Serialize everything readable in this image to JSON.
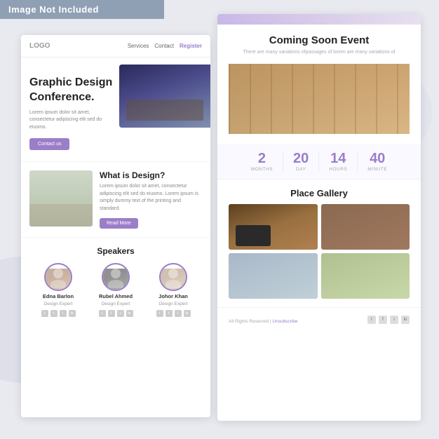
{
  "banner": {
    "text": "Image Not Included"
  },
  "card_left": {
    "nav": {
      "logo": "LOGO",
      "links": [
        "Services",
        "Contact"
      ],
      "register": "Register"
    },
    "hero": {
      "title": "Graphic Design Conference.",
      "description": "Lorem ipsum dolor sit amet, consectetur adipiscing elit  sed do eiusmo.",
      "button": "Contact us"
    },
    "what": {
      "title": "What is Design?",
      "description": "Lorem ipsum dolor sit amet, consectetur adipiscing elit  sed do eiusmo. Lorem ipsum is simply dummy text of the printing and standard.",
      "button": "Read More"
    },
    "speakers": {
      "title": "Speakers",
      "list": [
        {
          "name": "Edna Barlon",
          "role": "Design Expert"
        },
        {
          "name": "Rubel Ahmed",
          "role": "Design Expert"
        },
        {
          "name": "Johor Khan",
          "role": "Design Expert"
        }
      ]
    }
  },
  "card_right": {
    "title": "Coming Soon Event",
    "description": "There are many variations ofpassages of lorem are many variations of",
    "countdown": {
      "months": {
        "value": "2",
        "label": "MONTHS"
      },
      "days": {
        "value": "20",
        "label": "DAY"
      },
      "hours": {
        "value": "14",
        "label": "HOURS"
      },
      "minutes": {
        "value": "40",
        "label": "MINUTE"
      }
    },
    "gallery": {
      "title": "Place Gallery"
    },
    "footer": {
      "text": "All Rights Reserved | ",
      "unsubscribe": "Unsubscribe"
    }
  }
}
